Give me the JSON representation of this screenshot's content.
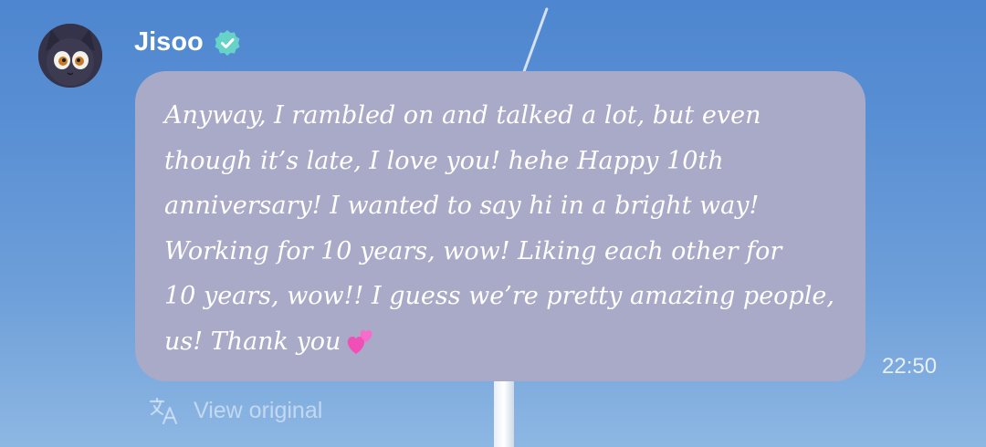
{
  "sender": {
    "name": "Jisoo",
    "verified_color": "#67d3c8",
    "avatar_icon": "cat-avatar"
  },
  "message": {
    "lines": [
      "Anyway, I rambled on and talked a lot, but even",
      "though it’s late, I love you! hehe Happy 10th",
      "anniversary! I wanted to say hi in a bright way!",
      "Working for 10 years, wow! Liking each other for",
      "10 years, wow!! I guess we’re pretty amazing people,",
      "us! Thank you"
    ],
    "emoji": "two-hearts",
    "time": "22:50",
    "bubble_color": "#a9a9c8"
  },
  "translation": {
    "view_original_label": "View original",
    "icon": "translate-icon"
  }
}
